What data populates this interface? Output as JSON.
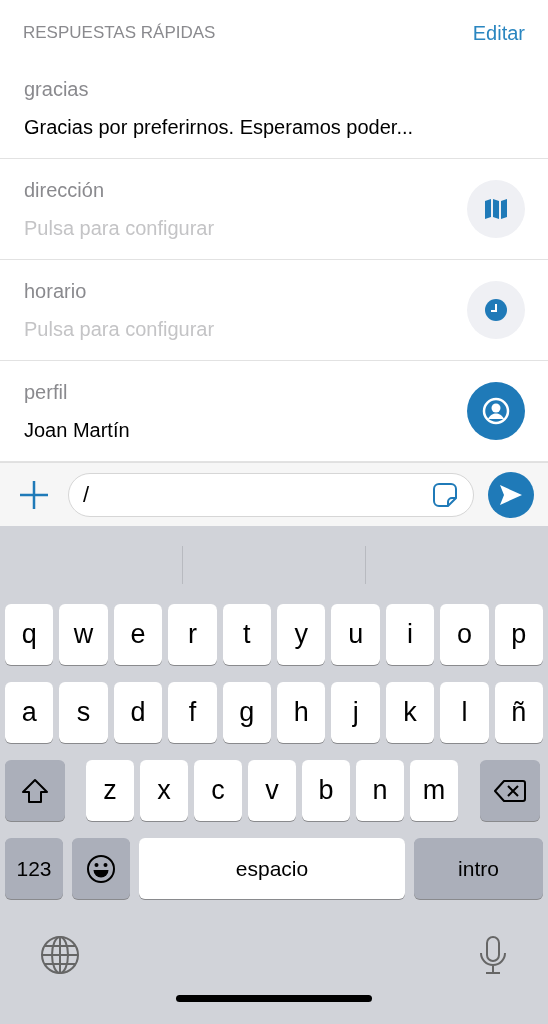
{
  "header": {
    "title": "RESPUESTAS RÁPIDAS",
    "action": "Editar"
  },
  "replies": [
    {
      "label": "gracias",
      "text": "Gracias por preferirnos. Esperamos poder...",
      "configured": true,
      "kind": "text"
    },
    {
      "label": "dirección",
      "text": "Pulsa para configurar",
      "configured": false,
      "kind": "map"
    },
    {
      "label": "horario",
      "text": "Pulsa para configurar",
      "configured": false,
      "kind": "clock"
    },
    {
      "label": "perfil",
      "text": "Joan Martín",
      "configured": true,
      "kind": "profile"
    }
  ],
  "composer": {
    "value": "/"
  },
  "keyboard": {
    "rows": [
      [
        "q",
        "w",
        "e",
        "r",
        "t",
        "y",
        "u",
        "i",
        "o",
        "p"
      ],
      [
        "a",
        "s",
        "d",
        "f",
        "g",
        "h",
        "j",
        "k",
        "l",
        "ñ"
      ],
      [
        "z",
        "x",
        "c",
        "v",
        "b",
        "n",
        "m"
      ]
    ],
    "numbers_key": "123",
    "space_key": "espacio",
    "return_key": "intro"
  }
}
